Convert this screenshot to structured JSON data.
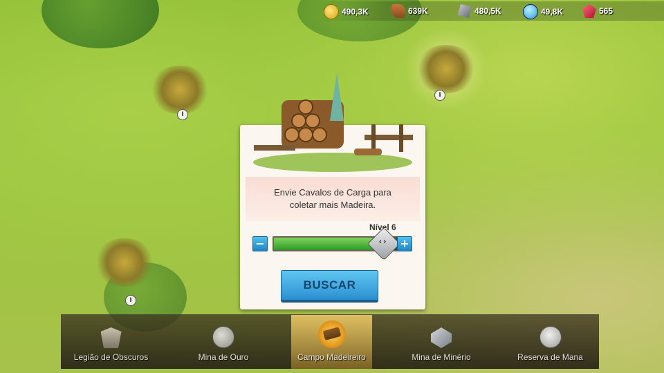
{
  "resources": [
    {
      "icon": "gold-coin-icon",
      "value": "490,3K"
    },
    {
      "icon": "wood-icon",
      "value": "639K"
    },
    {
      "icon": "ore-icon",
      "value": "480,5K"
    },
    {
      "icon": "mana-icon",
      "value": "49,8K"
    },
    {
      "icon": "gem-icon",
      "value": "565"
    }
  ],
  "map": {
    "site_markers": [
      "I",
      "I",
      "I"
    ]
  },
  "dialog": {
    "message": "Envie Cavalos de Carga para coletar mais Madeira.",
    "level_label": "Nível 6",
    "level_value": 6,
    "slider_fill_fraction": 0.9,
    "minus_label": "−",
    "plus_label": "+",
    "action_button": "BUSCAR"
  },
  "nav": {
    "tabs": [
      {
        "label": "Legião de Obscuros",
        "icon": "legion-icon",
        "active": false
      },
      {
        "label": "Mina de Ouro",
        "icon": "gold-mine-icon",
        "active": false
      },
      {
        "label": "Campo Madeireiro",
        "icon": "lumber-camp-icon",
        "active": true
      },
      {
        "label": "Mina de Minério",
        "icon": "ore-mine-icon",
        "active": false
      },
      {
        "label": "Reserva de Mana",
        "icon": "mana-reserve-icon",
        "active": false
      }
    ]
  },
  "colors": {
    "accent_blue": "#2b8fd0",
    "slider_green": "#2f9a2a",
    "active_tab": "#ffc23c"
  }
}
